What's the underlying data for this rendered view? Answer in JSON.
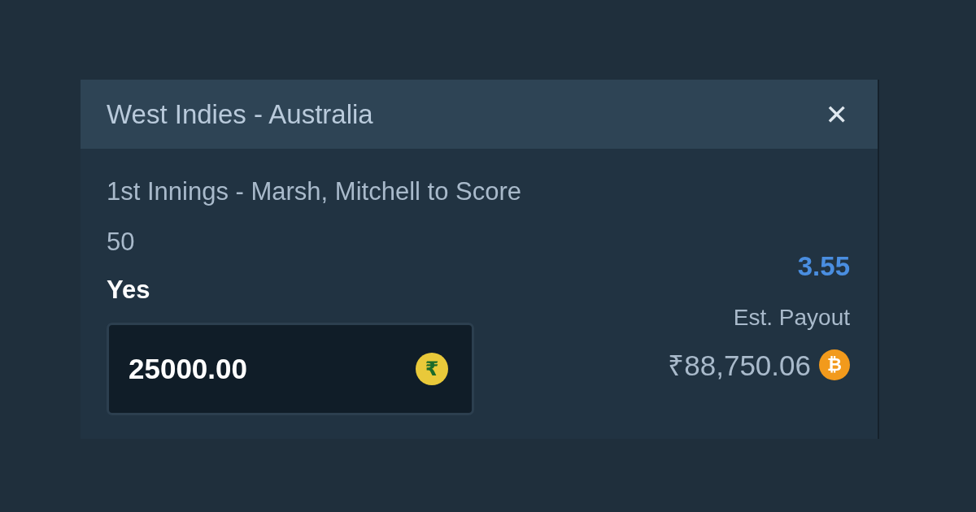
{
  "header": {
    "title": "West Indies - Australia",
    "close": "✕"
  },
  "market": {
    "description": "1st Innings - Marsh, Mitchell to Score 50",
    "selection": "Yes",
    "odds": "3.55"
  },
  "stake": {
    "value": "25000.00",
    "currency_symbol": "₹"
  },
  "payout": {
    "label": "Est. Payout",
    "amount": "₹88,750.06",
    "coin_symbol": "₿"
  }
}
